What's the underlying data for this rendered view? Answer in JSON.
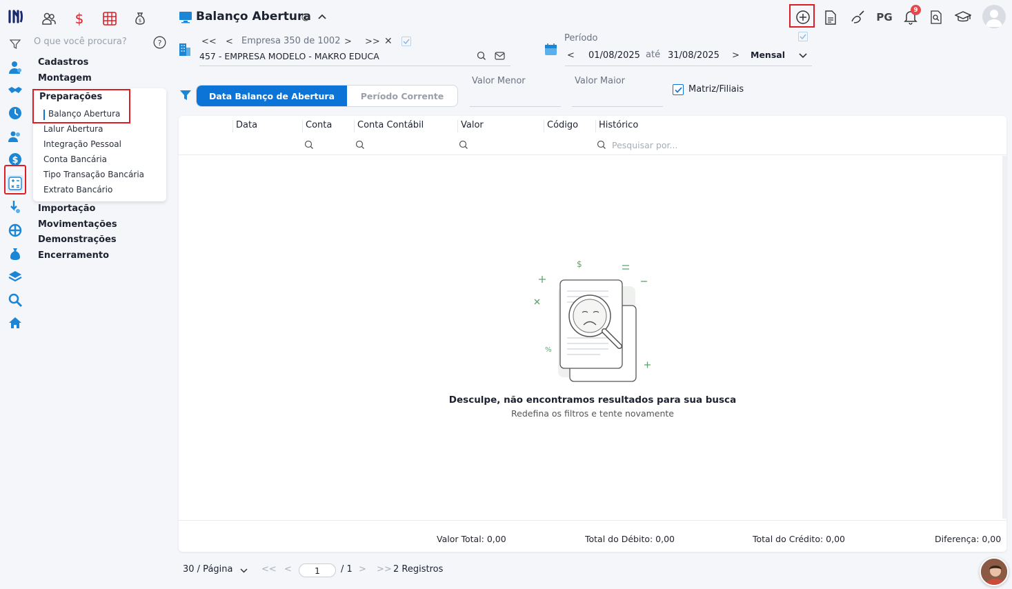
{
  "nav": {
    "search_placeholder": "O que você procura?",
    "sections": [
      "Cadastros",
      "Montagem"
    ],
    "active_section": "Preparações",
    "subitems": [
      "Balanço Abertura",
      "Lalur Abertura",
      "Integração Pessoal",
      "Conta Bancária",
      "Tipo Transação Bancária",
      "Extrato Bancário"
    ],
    "sections_after": [
      "Importação",
      "Movimentações",
      "Demonstrações",
      "Encerramento"
    ]
  },
  "header": {
    "title": "Balanço Abertura",
    "pg_label": "PG",
    "notification_count": "9"
  },
  "company": {
    "nav_text": "Empresa 350 de 1002",
    "name": "457 - EMPRESA MODELO - MAKRO EDUCA"
  },
  "period": {
    "label": "Período",
    "start": "01/08/2025",
    "connector": "até",
    "end": "31/08/2025",
    "frequency": "Mensal"
  },
  "filters": {
    "toggle_active": "Data Balanço de Abertura",
    "toggle_inactive": "Período Corrente",
    "min_label": "Valor Menor",
    "max_label": "Valor Maior",
    "matriz_label": "Matriz/Filiais"
  },
  "table": {
    "columns": [
      "Data",
      "Conta",
      "Conta Contábil",
      "Valor",
      "Código",
      "Histórico"
    ],
    "search_placeholder": "Pesquisar por...",
    "empty_title": "Desculpe, não encontramos resultados para sua busca",
    "empty_subtitle": "Redefina os filtros e tente novamente",
    "totals": {
      "valor_total": "Valor Total: 0,00",
      "debito": "Total do Débito: 0,00",
      "credito": "Total do Crédito: 0,00",
      "diferenca": "Diferença: 0,00"
    }
  },
  "pagination": {
    "per_page": "30 / Página",
    "page": "1",
    "of": "/ 1",
    "records": "2 Registros"
  },
  "colors": {
    "accent": "#0b74d6",
    "highlight": "#e01b24",
    "empty_green": "#5aa46a"
  }
}
